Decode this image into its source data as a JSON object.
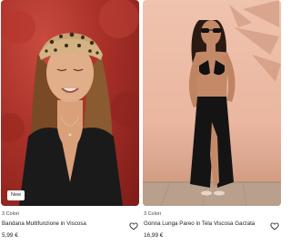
{
  "products": [
    {
      "colors_text": "3 Colori",
      "name": "Bandana Multifunzione in Viscosa",
      "price": "5,99 €",
      "badge": "New",
      "image_alt": "Woman with leopard print bandana on red background"
    },
    {
      "colors_text": "3 Colori",
      "name": "Gonna Lunga Pareo in Tela Viscosa Garzata",
      "price": "16,99 €",
      "image_alt": "Woman in black bikini and black sarong on pink wall"
    }
  ],
  "icons": {
    "favorite": "heart-outline-icon"
  },
  "colors": {
    "left_bg": "#a83028",
    "right_bg": "#eab69f"
  }
}
